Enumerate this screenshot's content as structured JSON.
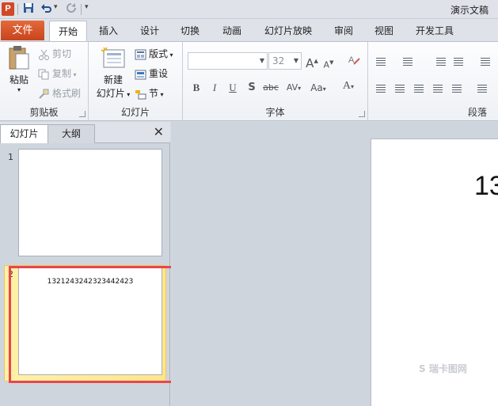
{
  "titlebar": {
    "app_icon": "P",
    "doc_title": "演示文稿",
    "icons": [
      "save-icon",
      "undo-icon",
      "redo-icon",
      "customize-qa-icon"
    ]
  },
  "tabs": {
    "file": "文件",
    "items": [
      "开始",
      "插入",
      "设计",
      "切换",
      "动画",
      "幻灯片放映",
      "审阅",
      "视图",
      "开发工具"
    ],
    "active": "开始"
  },
  "ribbon": {
    "clipboard": {
      "label": "剪贴板",
      "paste": "粘贴",
      "cut": "剪切",
      "copy": "复制",
      "format_painter": "格式刷"
    },
    "slides": {
      "label": "幻灯片",
      "new_slide_line1": "新建",
      "new_slide_line2": "幻灯片",
      "layout": "版式",
      "reset": "重设",
      "section": "节"
    },
    "font": {
      "label": "字体",
      "font_name": "",
      "font_size": "32",
      "bold": "B",
      "italic": "I",
      "underline": "U",
      "shadow": "S",
      "strike": "abc",
      "spacing": "AV",
      "case": "Aa",
      "color": "A",
      "grow": "A",
      "shrink": "A"
    },
    "paragraph": {
      "label": "段落"
    }
  },
  "left_pane": {
    "tab_slides": "幻灯片",
    "tab_outline": "大纲",
    "close": "✕",
    "slides": [
      {
        "number": "1",
        "text": ""
      },
      {
        "number": "2",
        "text": "1321243242323442423"
      }
    ]
  },
  "main": {
    "slide_text": "13",
    "watermark": "S 瑞卡图网"
  },
  "colors": {
    "file_tab": "#d24726",
    "selection_highlight": "#ffe58a",
    "annotation_red": "#e8474b"
  }
}
